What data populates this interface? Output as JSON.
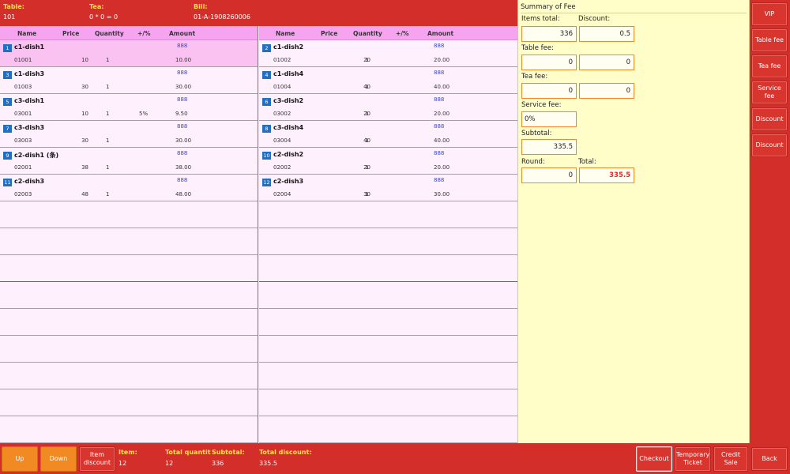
{
  "header": {
    "table_label": "Table:",
    "table_value": "101",
    "tea_label": "Tea:",
    "tea_value": "0 * 0 = 0",
    "bill_label": "Bill:",
    "bill_value": "01-A-1908260006"
  },
  "columns": {
    "name": "Name",
    "price": "Price",
    "quantity": "Quantity",
    "pct": "+/%",
    "amount": "Amount"
  },
  "left_items": [
    {
      "num": "1",
      "name": "c1-dish1",
      "code": "01001",
      "price": "10",
      "qty": "1",
      "pct": "",
      "amount": "10.00",
      "tag": "888"
    },
    {
      "num": "3",
      "name": "c1-dish3",
      "code": "01003",
      "price": "30",
      "qty": "1",
      "pct": "",
      "amount": "30.00",
      "tag": "888"
    },
    {
      "num": "5",
      "name": "c3-dish1",
      "code": "03001",
      "price": "10",
      "qty": "1",
      "pct": "5%",
      "amount": "9.50",
      "tag": "888"
    },
    {
      "num": "7",
      "name": "c3-dish3",
      "code": "03003",
      "price": "30",
      "qty": "1",
      "pct": "",
      "amount": "30.00",
      "tag": "888"
    },
    {
      "num": "9",
      "name": "c2-dish1 (条)",
      "code": "02001",
      "price": "38",
      "qty": "1",
      "pct": "",
      "amount": "38.00",
      "tag": "888"
    },
    {
      "num": "11",
      "name": "c2-dish3",
      "code": "02003",
      "price": "48",
      "qty": "1",
      "pct": "",
      "amount": "48.00",
      "tag": "888"
    }
  ],
  "right_items": [
    {
      "num": "2",
      "name": "c1-dish2",
      "code": "01002",
      "price": "20",
      "qty": "1",
      "pct": "",
      "amount": "20.00",
      "tag": "888"
    },
    {
      "num": "4",
      "name": "c1-dish4",
      "code": "01004",
      "price": "40",
      "qty": "1",
      "pct": "",
      "amount": "40.00",
      "tag": "888"
    },
    {
      "num": "6",
      "name": "c3-dish2",
      "code": "03002",
      "price": "20",
      "qty": "1",
      "pct": "",
      "amount": "20.00",
      "tag": "888"
    },
    {
      "num": "8",
      "name": "c3-dish4",
      "code": "03004",
      "price": "40",
      "qty": "1",
      "pct": "",
      "amount": "40.00",
      "tag": "888"
    },
    {
      "num": "10",
      "name": "c2-dish2",
      "code": "02002",
      "price": "20",
      "qty": "1",
      "pct": "",
      "amount": "20.00",
      "tag": "888"
    },
    {
      "num": "12",
      "name": "c2-dish3",
      "code": "02004",
      "price": "30",
      "qty": "1",
      "pct": "",
      "amount": "30.00",
      "tag": "888"
    }
  ],
  "summary": {
    "title": "Summary of Fee",
    "items_total_label": "Items total:",
    "items_total": "336",
    "discount_label": "Discount:",
    "discount": "0.5",
    "table_fee_label": "Table fee:",
    "table_fee_a": "0",
    "table_fee_b": "0",
    "tea_fee_label": "Tea fee:",
    "tea_fee_a": "0",
    "tea_fee_b": "0",
    "service_fee_label": "Service fee:",
    "service_fee_pct": "0%",
    "service_fee": "0",
    "subtotal_label": "Subtotal:",
    "subtotal": "335.5",
    "round_label": "Round:",
    "round": "0",
    "total_label": "Total:",
    "total": "335.5"
  },
  "side_buttons": {
    "vip": "VIP",
    "table_fee": "Table fee",
    "tea_fee": "Tea fee",
    "service_fee": "Service fee",
    "discount1": "Discount",
    "discount2": "Discount",
    "back": "Back"
  },
  "footer": {
    "up": "Up",
    "down": "Down",
    "item_discount": "Item discount",
    "item_label": "Item:",
    "item_value": "12",
    "total_qty_label": "Total quantit",
    "total_qty_value": "12",
    "subtotal_label": "Subtotal:",
    "subtotal_value": "336",
    "total_discount_label": "Total discount:",
    "total_discount_value": "335.5",
    "checkout": "Checkout",
    "temporary_ticket": "Temporary Ticket",
    "credit_sale": "Credit Sale"
  }
}
